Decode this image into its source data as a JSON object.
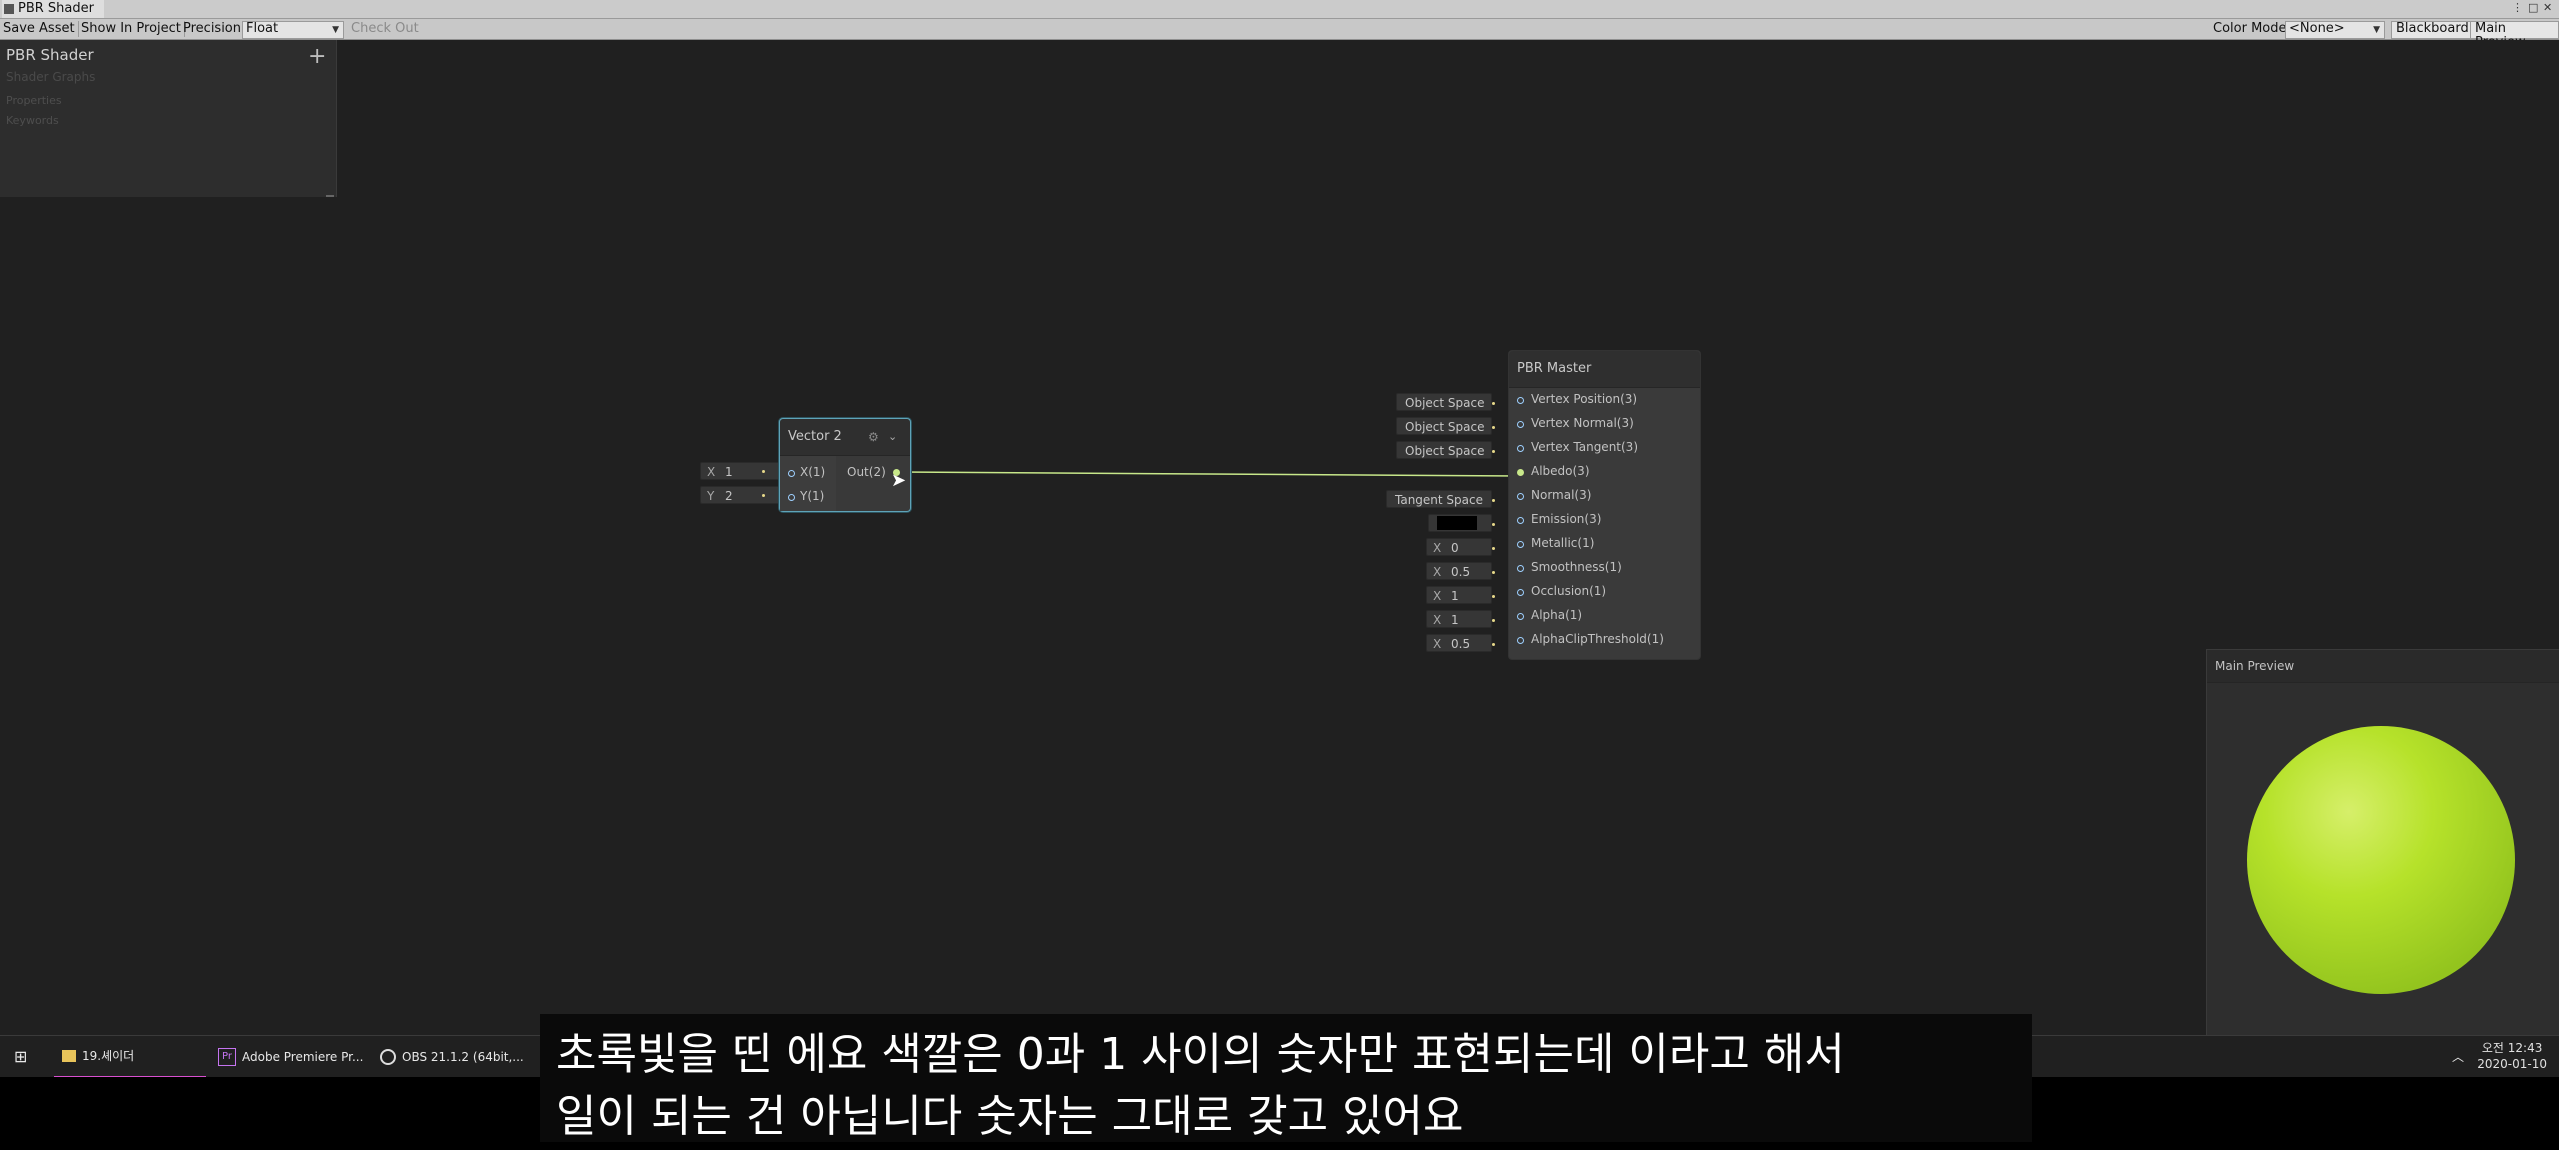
{
  "window": {
    "title": "PBR Shader"
  },
  "toolbar": {
    "save_asset": "Save Asset",
    "show_in_project": "Show In Project",
    "precision_label": "Precision",
    "precision_value": "Float",
    "check_out": "Check Out",
    "color_mode_label": "Color Mode",
    "color_mode_value": "<None>",
    "blackboard": "Blackboard",
    "main_preview": "Main Preview"
  },
  "blackboard": {
    "title": "PBR Shader",
    "subtitle": "Shader Graphs",
    "sections": [
      "Properties",
      "Keywords"
    ],
    "add_icon": "+"
  },
  "vector2_node": {
    "title": "Vector 2",
    "inputs": [
      {
        "axis": "X",
        "value": "1",
        "port": "X(1)"
      },
      {
        "axis": "Y",
        "value": "2",
        "port": "Y(1)"
      }
    ],
    "output": "Out(2)"
  },
  "pbr_master": {
    "title": "PBR Master",
    "ports": [
      {
        "label": "Vertex Position(3)",
        "control": "Object Space"
      },
      {
        "label": "Vertex Normal(3)",
        "control": "Object Space"
      },
      {
        "label": "Vertex Tangent(3)",
        "control": "Object Space"
      },
      {
        "label": "Albedo(3)",
        "control": ""
      },
      {
        "label": "Normal(3)",
        "control": "Tangent Space"
      },
      {
        "label": "Emission(3)",
        "control": "color"
      },
      {
        "label": "Metallic(1)",
        "control": "X",
        "value": "0"
      },
      {
        "label": "Smoothness(1)",
        "control": "X",
        "value": "0.5"
      },
      {
        "label": "Occlusion(1)",
        "control": "X",
        "value": "1"
      },
      {
        "label": "Alpha(1)",
        "control": "X",
        "value": "1"
      },
      {
        "label": "AlphaClipThreshold(1)",
        "control": "X",
        "value": "0.5"
      }
    ]
  },
  "main_preview": {
    "title": "Main Preview",
    "sphere_color": "#b6e22a"
  },
  "taskbar": {
    "items": [
      "19.셰이더",
      "Adobe Premiere Pr...",
      "OBS 21.1.2 (64bit,..."
    ],
    "clock_time": "오전 12:43",
    "clock_date": "2020-01-10"
  },
  "subtitle": {
    "line1": "초록빛을 띤 에요 색깔은 0과 1 사이의 숫자만 표현되는데 이라고 해서",
    "line2": "일이 되는 건 아닙니다 숫자는 그대로 갖고 있어요"
  },
  "colors": {
    "wire": "#c8e88a",
    "port": "#9ed0ff",
    "accent_taskbar": "#d94fd0"
  }
}
